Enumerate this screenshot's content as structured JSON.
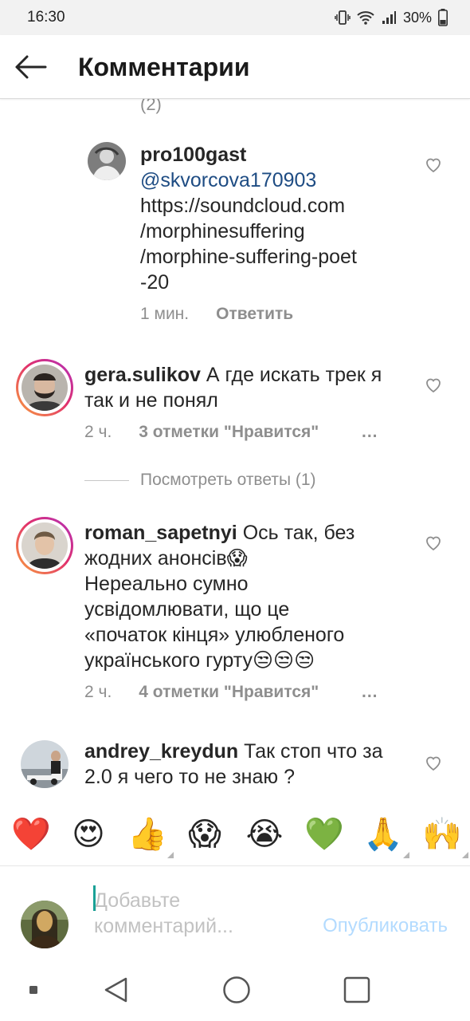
{
  "status_bar": {
    "time": "16:30",
    "battery": "30%"
  },
  "header": {
    "title": "Комментарии"
  },
  "truncated_count": "(2)",
  "comments": [
    {
      "username": "pro100gast",
      "mention": "@skvorcova170903",
      "lines": [
        "https://soundcloud.com",
        "/morphinesuffering",
        "/morphine-suffering-poet",
        "-20"
      ],
      "time": "1 мин.",
      "reply_label": "Ответить"
    },
    {
      "username": "gera.sulikov",
      "text_first": "А где искать трек я",
      "lines": [
        "так и не понял"
      ],
      "time": "2 ч.",
      "likes": "3 отметки \"Нравится\"",
      "more": "...",
      "view_replies": "Посмотреть ответы (1)"
    },
    {
      "username": "roman_sapetnyi",
      "text_first": "Ось так, без",
      "lines": [
        "жодних анонсів😱",
        "Нереально сумно",
        "усвідомлювати, що це",
        "«початок кінця» улюбленого",
        "українського гурту😒😒😒"
      ],
      "time": "2 ч.",
      "likes": "4 отметки \"Нравится\"",
      "more": "..."
    },
    {
      "username": "andrey_kreydun",
      "text_first": "Так стоп что за",
      "lines": [
        "2.0 я чего то не знаю ?"
      ]
    }
  ],
  "emoji_bar": [
    "❤️",
    "😍",
    "👍",
    "😱",
    "😭",
    "💚",
    "🙏",
    "🙌"
  ],
  "emoji_colors": {
    "heart": "#e0203a",
    "yellow": "#ffcc33",
    "green": "#5fb030"
  },
  "input": {
    "placeholder": "Добавьте комментарий...",
    "publish_label": "Опубликовать"
  },
  "colors": {
    "mention": "#1e4c83",
    "publish_disabled": "#b3dbff",
    "meta": "#8e8e8e"
  }
}
